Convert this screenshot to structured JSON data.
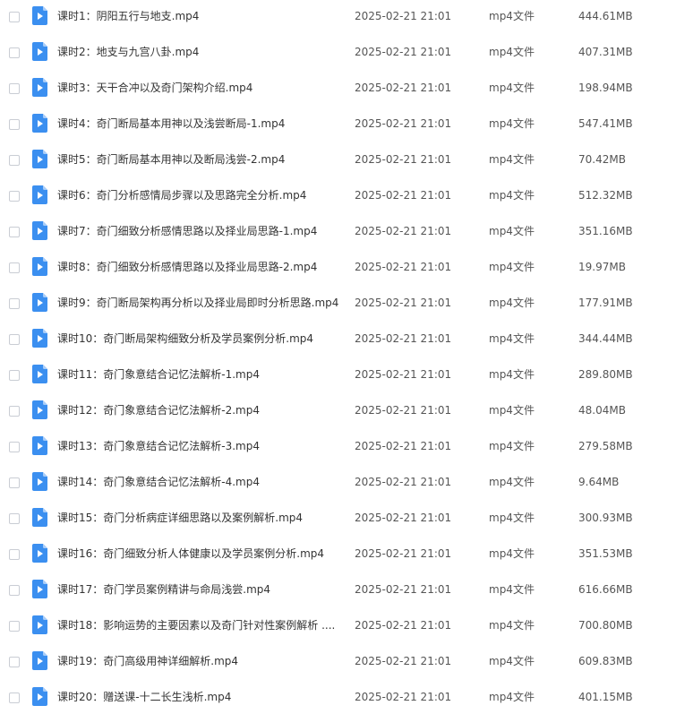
{
  "files": [
    {
      "name": "课时1：阴阳五行与地支.mp4",
      "date": "2025-02-21 21:01",
      "type": "mp4文件",
      "size": "444.61MB"
    },
    {
      "name": "课时2：地支与九宫八卦.mp4",
      "date": "2025-02-21 21:01",
      "type": "mp4文件",
      "size": "407.31MB"
    },
    {
      "name": "课时3：天干合冲以及奇门架构介绍.mp4",
      "date": "2025-02-21 21:01",
      "type": "mp4文件",
      "size": "198.94MB"
    },
    {
      "name": "课时4：奇门断局基本用神以及浅尝断局-1.mp4",
      "date": "2025-02-21 21:01",
      "type": "mp4文件",
      "size": "547.41MB"
    },
    {
      "name": "课时5：奇门断局基本用神以及断局浅尝-2.mp4",
      "date": "2025-02-21 21:01",
      "type": "mp4文件",
      "size": "70.42MB"
    },
    {
      "name": "课时6：奇门分析感情局步骤以及思路完全分析.mp4",
      "date": "2025-02-21 21:01",
      "type": "mp4文件",
      "size": "512.32MB"
    },
    {
      "name": "课时7：奇门细致分析感情思路以及择业局思路-1.mp4",
      "date": "2025-02-21 21:01",
      "type": "mp4文件",
      "size": "351.16MB"
    },
    {
      "name": "课时8：奇门细致分析感情思路以及择业局思路-2.mp4",
      "date": "2025-02-21 21:01",
      "type": "mp4文件",
      "size": "19.97MB"
    },
    {
      "name": "课时9：奇门断局架构再分析以及择业局即时分析思路.mp4",
      "date": "2025-02-21 21:01",
      "type": "mp4文件",
      "size": "177.91MB"
    },
    {
      "name": "课时10：奇门断局架构细致分析及学员案例分析.mp4",
      "date": "2025-02-21 21:01",
      "type": "mp4文件",
      "size": "344.44MB"
    },
    {
      "name": "课时11：奇门象意结合记忆法解析-1.mp4",
      "date": "2025-02-21 21:01",
      "type": "mp4文件",
      "size": "289.80MB"
    },
    {
      "name": "课时12：奇门象意结合记忆法解析-2.mp4",
      "date": "2025-02-21 21:01",
      "type": "mp4文件",
      "size": "48.04MB"
    },
    {
      "name": "课时13：奇门象意结合记忆法解析-3.mp4",
      "date": "2025-02-21 21:01",
      "type": "mp4文件",
      "size": "279.58MB"
    },
    {
      "name": "课时14：奇门象意结合记忆法解析-4.mp4",
      "date": "2025-02-21 21:01",
      "type": "mp4文件",
      "size": "9.64MB"
    },
    {
      "name": "课时15：奇门分析病症详细思路以及案例解析.mp4",
      "date": "2025-02-21 21:01",
      "type": "mp4文件",
      "size": "300.93MB"
    },
    {
      "name": "课时16：奇门细致分析人体健康以及学员案例分析.mp4",
      "date": "2025-02-21 21:01",
      "type": "mp4文件",
      "size": "351.53MB"
    },
    {
      "name": "课时17：奇门学员案例精讲与命局浅尝.mp4",
      "date": "2025-02-21 21:01",
      "type": "mp4文件",
      "size": "616.66MB"
    },
    {
      "name": "课时18：影响运势的主要因素以及奇门针对性案例解析 ....",
      "date": "2025-02-21 21:01",
      "type": "mp4文件",
      "size": "700.80MB"
    },
    {
      "name": "课时19：奇门高级用神详细解析.mp4",
      "date": "2025-02-21 21:01",
      "type": "mp4文件",
      "size": "609.83MB"
    },
    {
      "name": "课时20：赠送课-十二长生浅析.mp4",
      "date": "2025-02-21 21:01",
      "type": "mp4文件",
      "size": "401.15MB"
    }
  ],
  "colors": {
    "icon_blue": "#3b8ff0",
    "icon_fold": "#a9cdf8",
    "text": "#333333",
    "checkbox_border": "#c9cdd4"
  },
  "icons": {
    "file": "video-file-icon",
    "select": "checkbox"
  }
}
